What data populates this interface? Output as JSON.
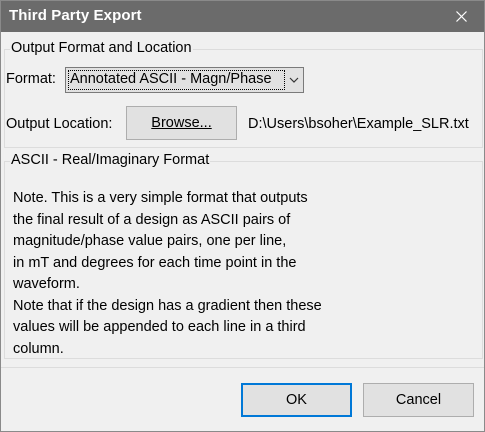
{
  "window": {
    "title": "Third Party Export",
    "close_icon": "close-icon"
  },
  "output_group": {
    "label": "Output Format and Location",
    "format_label": "Format:",
    "format_selected": "Annotated ASCII - Magn/Phase",
    "location_label": "Output Location:",
    "browse_label": "Browse...",
    "location_value": "D:\\Users\\bsoher\\Example_SLR.txt"
  },
  "format_group": {
    "label": "ASCII - Real/Imaginary Format",
    "note_lines": [
      "Note. This is a very simple format that outputs",
      "the final result of a design as ASCII pairs of",
      "magnitude/phase value pairs, one per line,",
      "in mT and degrees for each time point in the",
      "waveform.",
      "Note that if the design has a gradient then these",
      "values will be appended to each line in a third",
      "column."
    ]
  },
  "buttons": {
    "ok_label": "OK",
    "cancel_label": "Cancel"
  },
  "colors": {
    "titlebar": "#6b6b6b",
    "window_bg": "#f0f0f0",
    "default_button_border": "#0078d7"
  }
}
